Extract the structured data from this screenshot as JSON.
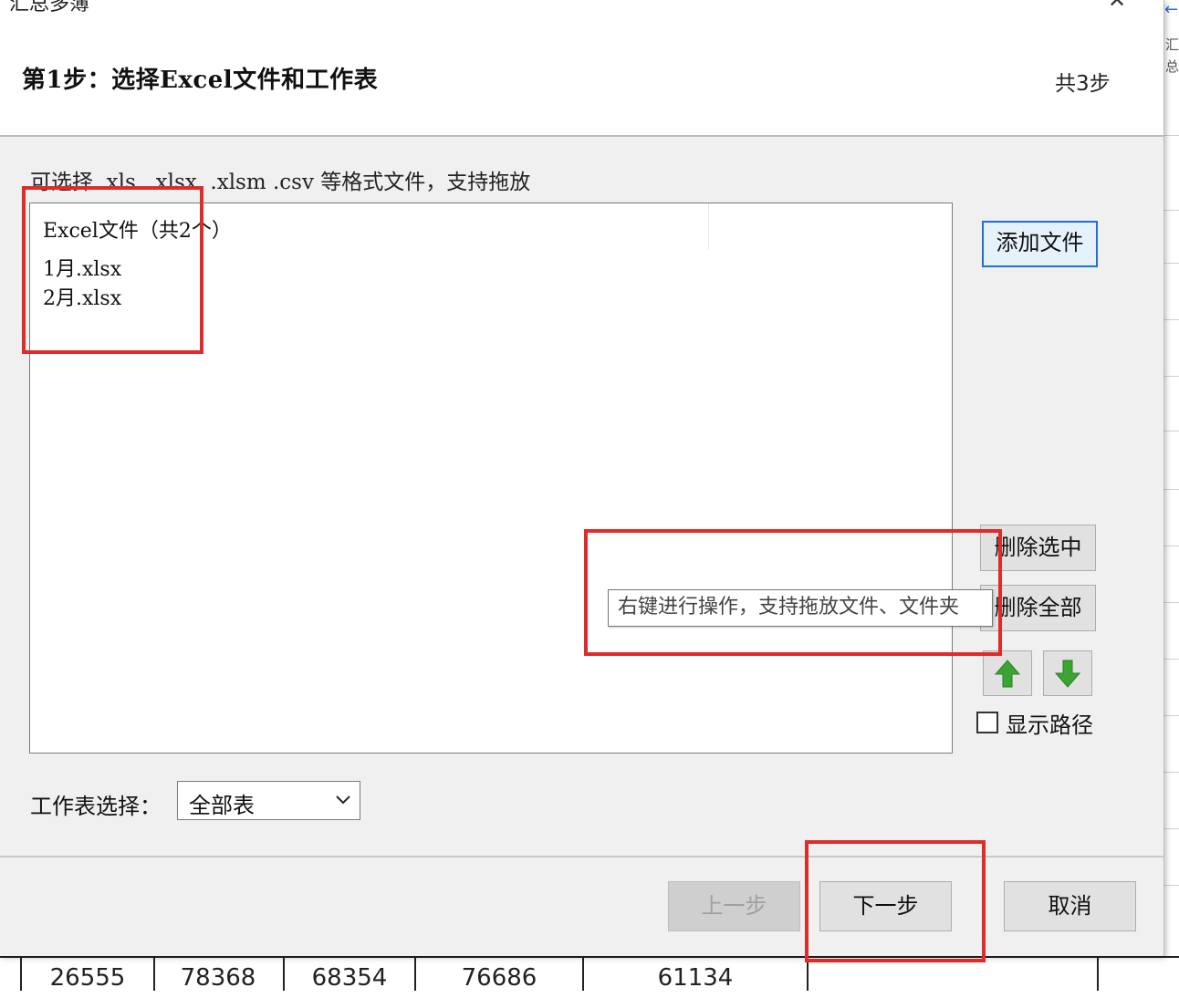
{
  "window": {
    "title": "汇总多簿",
    "close_glyph": "✕",
    "dot": "·"
  },
  "header": {
    "step_title": "第1步：选择Excel文件和工作表",
    "step_count": "共3步"
  },
  "hint": "可选择 .xls  .xlsx  .xlsm .csv 等格式文件，支持拖放",
  "file_list": {
    "header": "Excel文件（共2个）",
    "files": [
      "1月.xlsx",
      "2月.xlsx"
    ]
  },
  "buttons": {
    "add_file": "添加文件",
    "delete_selected": "删除选中",
    "delete_all": "删除全部",
    "prev": "上一步",
    "next": "下一步",
    "cancel": "取消"
  },
  "show_path": {
    "label": "显示路径",
    "checked": false
  },
  "worksheet": {
    "label": "工作表选择：",
    "selected": "全部表"
  },
  "tooltip": "右键进行操作，支持拖放文件、文件夹",
  "background_sheet": {
    "bottom_row": [
      "26555",
      "78368",
      "68354",
      "76686",
      "61134"
    ],
    "side_chars": [
      "汇",
      "总"
    ],
    "side_arrow": "←"
  },
  "colors": {
    "highlight": "#e02b2b",
    "focus": "#1e6fd9",
    "arrow_green": "#3aa435"
  }
}
